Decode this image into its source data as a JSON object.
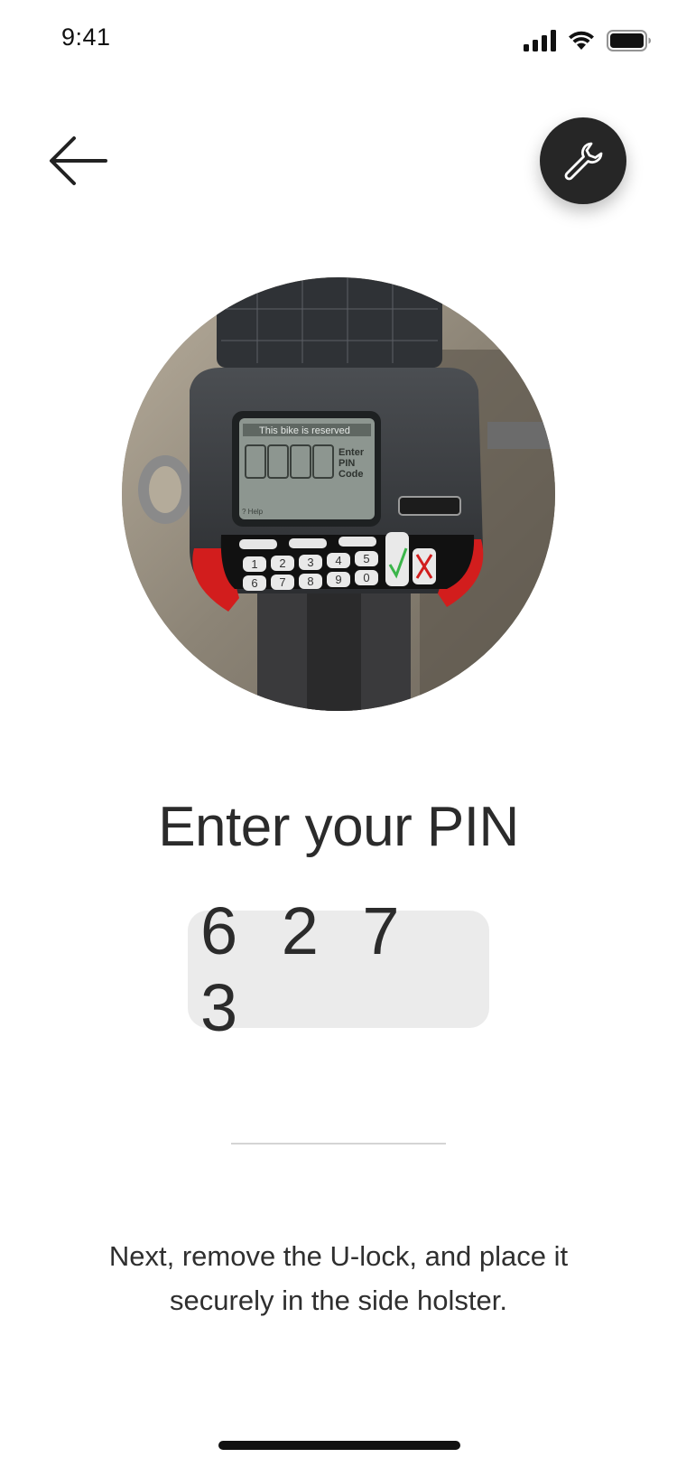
{
  "status_bar": {
    "time": "9:41",
    "icons": [
      "cellular-signal-icon",
      "wifi-icon",
      "battery-icon"
    ]
  },
  "header": {
    "back_icon": "arrow-left-icon",
    "tool_icon": "wrench-icon"
  },
  "photo": {
    "description_icon": "bike-dock-keypad-photo",
    "screen_line1": "This bike is reserved",
    "screen_line2": "Enter",
    "screen_line3": "PIN",
    "screen_line4": "Code",
    "screen_help": "? Help",
    "keys_row1": [
      "1",
      "2",
      "3",
      "4",
      "5"
    ],
    "keys_row2": [
      "6",
      "7",
      "8",
      "9",
      "0"
    ]
  },
  "main": {
    "title": "Enter your PIN",
    "pin": "6 2 7 3",
    "instruction": "Next, remove the U-lock, and place it securely in the side holster."
  },
  "colors": {
    "tool_button_bg": "#262626",
    "pin_box_bg": "#ebebeb",
    "text": "#2b2b2b"
  }
}
